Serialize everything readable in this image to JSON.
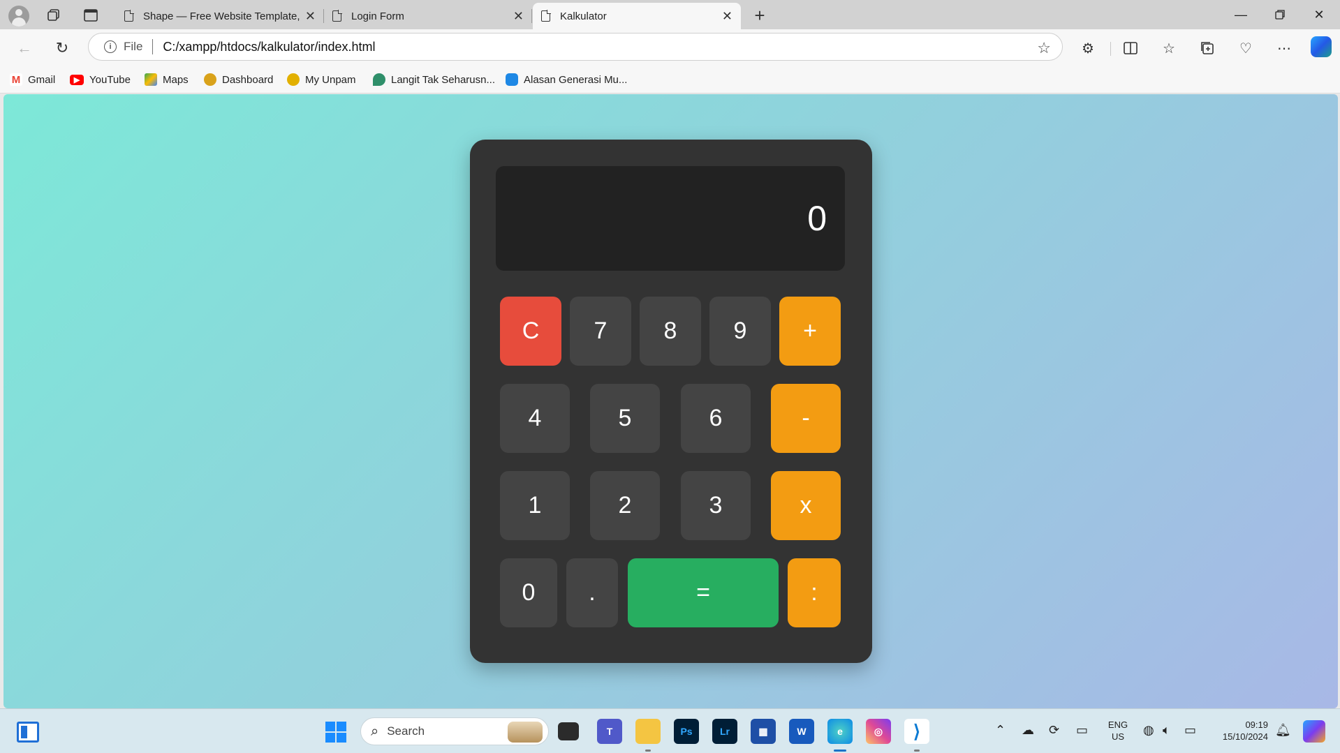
{
  "browser": {
    "tabs": [
      {
        "title": "Shape — Free Website Template,",
        "active": false
      },
      {
        "title": "Login Form",
        "active": false
      },
      {
        "title": "Kalkulator",
        "active": true
      }
    ],
    "address": {
      "scheme_label": "File",
      "url": "C:/xampp/htdocs/kalkulator/index.html"
    },
    "favorites": [
      {
        "label": "Gmail",
        "icon": "gmail-icon",
        "color": "#ea4335"
      },
      {
        "label": "YouTube",
        "icon": "youtube-icon",
        "color": "#ff0000"
      },
      {
        "label": "Maps",
        "icon": "maps-icon",
        "color": "#34a853"
      },
      {
        "label": "Dashboard",
        "icon": "dashboard-icon",
        "color": "#d9a21b"
      },
      {
        "label": "My Unpam",
        "icon": "unpam-icon",
        "color": "#e2b000"
      },
      {
        "label": "Langit Tak Seharusn...",
        "icon": "map-pin-icon",
        "color": "#2f8f6a"
      },
      {
        "label": "Alasan Generasi Mu...",
        "icon": "chat-icon",
        "color": "#1e88e5"
      }
    ]
  },
  "calculator": {
    "display": "0",
    "colors": {
      "body": "#333333",
      "display": "#222222",
      "key": "#444444",
      "clear": "#e74c3c",
      "operator": "#f39c12",
      "equals": "#27ae60"
    },
    "keys": {
      "clear": "C",
      "seven": "7",
      "eight": "8",
      "nine": "9",
      "plus": "+",
      "four": "4",
      "five": "5",
      "six": "6",
      "minus": "-",
      "one": "1",
      "two": "2",
      "three": "3",
      "multiply": "x",
      "zero": "0",
      "dot": ".",
      "equals": "=",
      "divide": ":"
    }
  },
  "taskbar": {
    "search_placeholder": "Search",
    "apps": [
      "file-explorer-icon",
      "teams-icon",
      "folder-icon",
      "photoshop-icon",
      "lightroom-icon",
      "store-icon",
      "word-icon",
      "edge-icon",
      "instagram-icon",
      "vscode-icon"
    ],
    "app_labels": {
      "photoshop": "Ps",
      "lightroom": "Lr",
      "word": "W"
    },
    "language": {
      "line1": "ENG",
      "line2": "US"
    },
    "clock": {
      "time": "09:19",
      "date": "15/10/2024"
    }
  }
}
